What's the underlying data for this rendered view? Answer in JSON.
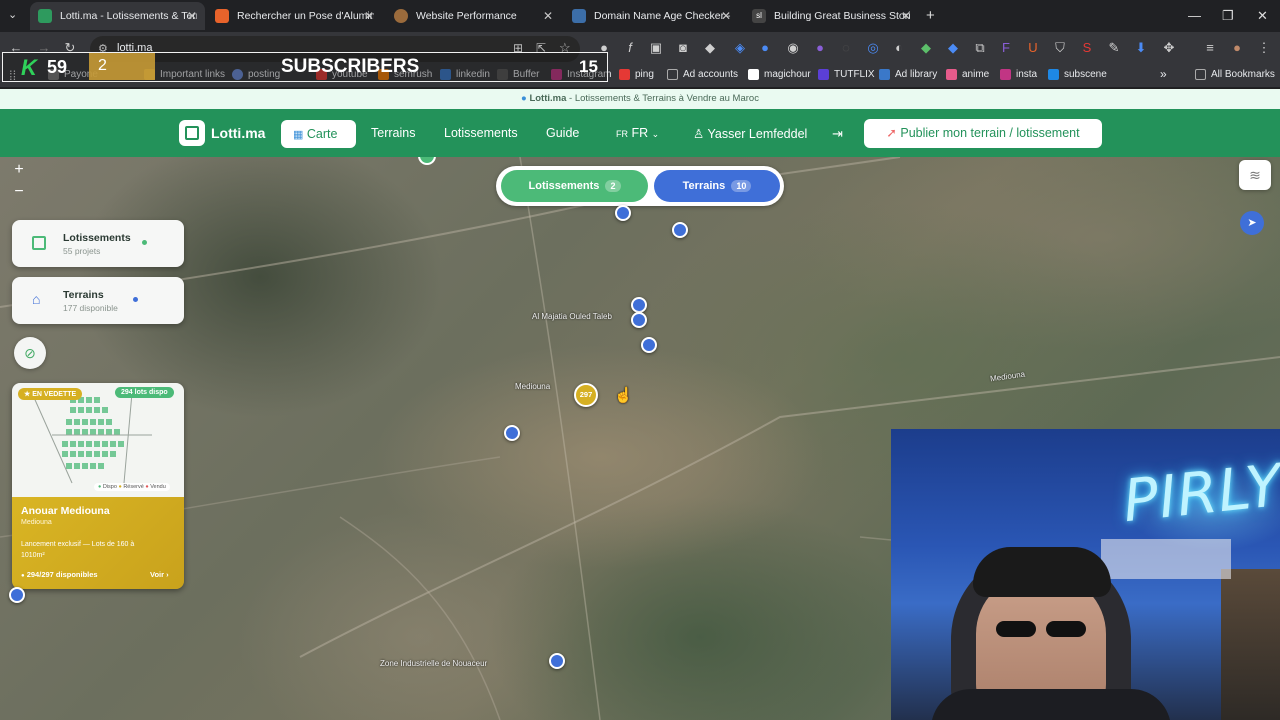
{
  "browser": {
    "tabs": [
      {
        "title": "Lotti.ma - Lotissements & Terra",
        "active": true,
        "fav_color": "#2e9a5e"
      },
      {
        "title": "Rechercher un Pose d'Aluminiu",
        "active": false,
        "fav_color": "#e8632b"
      },
      {
        "title": "Website Performance",
        "active": false,
        "fav_color": "#9b6b3c"
      },
      {
        "title": "Domain Name Age Checker - C",
        "active": false,
        "fav_color": "#3c6ea8"
      },
      {
        "title": "Building Great Business Stories",
        "active": false,
        "fav_color": "#444444"
      }
    ],
    "url": "lotti.ma",
    "new_tab_label": "+",
    "bookmarks": [
      {
        "label": "Payone",
        "color": "#777777"
      },
      {
        "label": "Important links",
        "color": "#f2c94c"
      },
      {
        "label": "posting",
        "color": "#6a8bd8"
      },
      {
        "label": "youtube",
        "color": "#e53935"
      },
      {
        "label": "semrush",
        "color": "#f57c00"
      },
      {
        "label": "linkedin",
        "color": "#3a78c9"
      },
      {
        "label": "Buffer",
        "color": "#555555"
      },
      {
        "label": "Instagram",
        "color": "#c13584"
      },
      {
        "label": "ping",
        "color": "#e53935"
      },
      {
        "label": "Ad accounts",
        "color": "#999999"
      },
      {
        "label": "magichour",
        "color": "#ffffff"
      },
      {
        "label": "TUTFLIX",
        "color": "#5b3fd6"
      },
      {
        "label": "Ad library",
        "color": "#3a78c9"
      },
      {
        "label": "anime",
        "color": "#e65b8b"
      },
      {
        "label": "insta",
        "color": "#c13584"
      },
      {
        "label": "subscene",
        "color": "#1e88e5"
      }
    ],
    "bookmarks_more": "»",
    "all_bookmarks": "All Bookmarks"
  },
  "overlay": {
    "logo_letter": "K",
    "count_left": "59",
    "count_mid": "2",
    "title": "SUBSCRIBERS",
    "count_right": "15"
  },
  "site": {
    "banner_brand": "Lotti.ma",
    "banner_text": " - Lotissements & Terrains à Vendre au Maroc",
    "logo_text": "Lotti.ma",
    "nav": {
      "carte": "Carte",
      "terrains": "Terrains",
      "lotissements": "Lotissements",
      "guide": "Guide",
      "lang_flag": "FR",
      "lang": "FR",
      "user": "Yasser Lemfeddel",
      "publish": "Publier mon terrain / lotissement"
    },
    "colors": {
      "brand_green": "#23925a",
      "pin_blue": "#3f6fd8",
      "accent_gold": "#d6b023",
      "toggle_blue": "#3f6fd8"
    }
  },
  "map": {
    "toggle": {
      "lotissements_label": "Lotissements",
      "lotissements_count": "2",
      "terrains_label": "Terrains",
      "terrains_count": "10"
    },
    "zoom_in": "+",
    "zoom_out": "−",
    "cluster_label": "297",
    "labels": [
      "Al Majatia Ouled Taleb",
      "Mediouna",
      "Mediouna",
      "Zone Industrielle de Nouaceur"
    ],
    "panels": {
      "lotissements_title": "Lotissements",
      "lotissements_sub": "55 projets",
      "terrains_title": "Terrains",
      "terrains_sub": "177 disponible"
    },
    "featured": {
      "badge": "EN VEDETTE",
      "lots_badge": "294 lots dispo",
      "legend": [
        "Dispo",
        "Réservé",
        "Vendu"
      ],
      "title": "Anouar Mediouna",
      "city": "Mediouna",
      "description": "Lancement exclusif — Lots de 160 à 1010m²",
      "availability": "294/297 disponibles",
      "link": "Voir"
    }
  },
  "webcam": {
    "neon_text": "PIRLY"
  }
}
